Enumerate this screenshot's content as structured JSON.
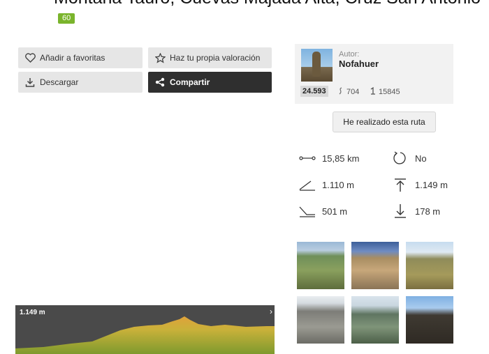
{
  "route": {
    "title": "Montaña Tauro, Cuevas Majada Alta, Cruz San Antonio",
    "badge": "60"
  },
  "actions": {
    "favorite_label": "Añadir a favoritas",
    "rate_label": "Haz tu propia valoración",
    "download_label": "Descargar",
    "share_label": "Compartir"
  },
  "author": {
    "label": "Autor:",
    "name": "Nofahuer",
    "points": "24.593",
    "routes": "704",
    "followers": "15845"
  },
  "done_button": "He realizado esta ruta",
  "metrics": {
    "distance": "15,85 km",
    "loop": "No",
    "max_altitude": "1.110 m",
    "elevation_gain": "1.149 m",
    "min_altitude": "501 m",
    "elevation_loss": "178 m"
  },
  "profile": {
    "max_label": "1.149 m"
  },
  "photos": [
    "photo-1",
    "photo-2",
    "photo-3",
    "photo-4",
    "photo-5",
    "photo-6"
  ],
  "colors": {
    "badge": "#7ab42c",
    "dark_button": "#2f2f2f",
    "light_button": "#e6e6e6",
    "profile_bg": "#4a4a4a"
  }
}
